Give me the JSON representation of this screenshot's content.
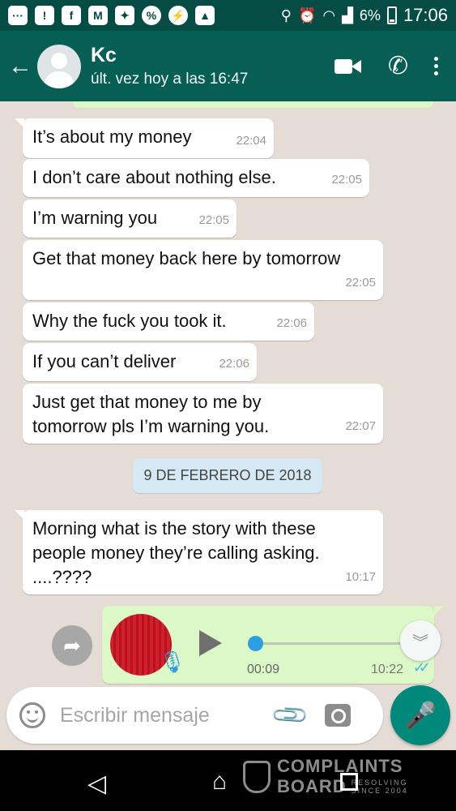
{
  "status_bar": {
    "battery": "6%",
    "time": "17:06"
  },
  "header": {
    "contact_name": "Kc",
    "last_seen": "últ. vez hoy a las 16:47"
  },
  "messages": [
    {
      "text": "It’s about my money",
      "time": "22:04"
    },
    {
      "text": "I don’t care about nothing else.",
      "time": "22:05"
    },
    {
      "text": "I’m warning you",
      "time": "22:05"
    },
    {
      "text": "Get that money back here by tomorrow",
      "time": "22:05"
    },
    {
      "text": "Why the fuck you took it.",
      "time": "22:06"
    },
    {
      "text": "If you can’t deliver",
      "time": "22:06"
    },
    {
      "text": "Just get that money to me by tomorrow pls I’m warning you.",
      "time": "22:07"
    }
  ],
  "date_divider": "9 DE FEBRERO DE 2018",
  "message_after_divider": {
    "text": "Morning what is the story with these people money they’re calling asking. ....????",
    "time": "10:17"
  },
  "voice_note": {
    "duration": "00:09",
    "time": "10:22",
    "progress": 0
  },
  "composer": {
    "placeholder": "Escribir mensaje"
  },
  "watermark": {
    "line1": "COMPLAINTS",
    "line2": "BOARD",
    "line3a": "RESOLVING",
    "line3b": "SINCE 2004"
  },
  "colors": {
    "header": "#075e54",
    "status_bar": "#054d44",
    "outgoing_bubble": "#dcf8c6",
    "incoming_bubble": "#ffffff",
    "chat_background": "#e5ddd5",
    "accent": "#00897b",
    "audio_progress": "#2d9ee0"
  },
  "icons": [
    "back-arrow-icon",
    "video-call-icon",
    "phone-icon",
    "more-options-icon",
    "forward-icon",
    "scroll-down-icon",
    "emoji-icon",
    "attach-icon",
    "camera-icon",
    "mic-icon",
    "play-icon"
  ]
}
